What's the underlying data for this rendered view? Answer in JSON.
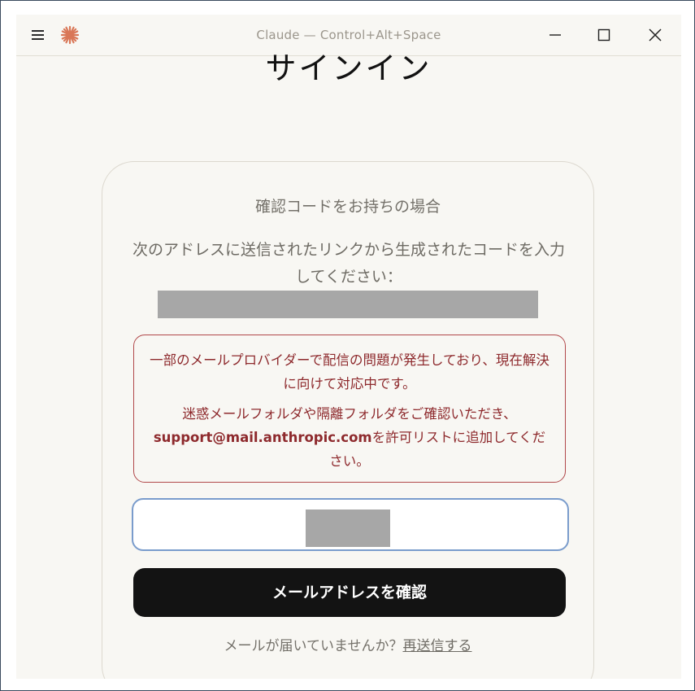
{
  "window": {
    "title": "Claude — Control+Alt+Space"
  },
  "icons": {
    "menu": "hamburger-menu-icon",
    "logo": "claude-logo-icon",
    "minimize": "minimize-icon",
    "maximize": "maximize-icon",
    "close": "close-icon"
  },
  "colors": {
    "logo": "#d97757",
    "alert_text": "#8e2a2d",
    "alert_border": "#b1484a",
    "input_border": "#7a9ccc",
    "button_bg": "#131313"
  },
  "page": {
    "heading": "サインイン"
  },
  "card": {
    "subtitle": "確認コードをお持ちの場合",
    "description": "次のアドレスに送信されたリンクから生成されたコードを入力してください：",
    "alert": {
      "line1": "一部のメールプロバイダーで配信の問題が発生しており、現在解決に向けて対応中です。",
      "line2_prefix": "迷惑メールフォルダや隔離フォルダをご確認いただき、",
      "email": "support@mail.anthropic.com",
      "line2_suffix": "を許可リストに追加してください。"
    },
    "code_input": {
      "value": "",
      "placeholder": ""
    },
    "confirm_button": "メールアドレスを確認",
    "resend_prompt": "メールが届いていませんか？",
    "resend_link": "再送信する"
  }
}
